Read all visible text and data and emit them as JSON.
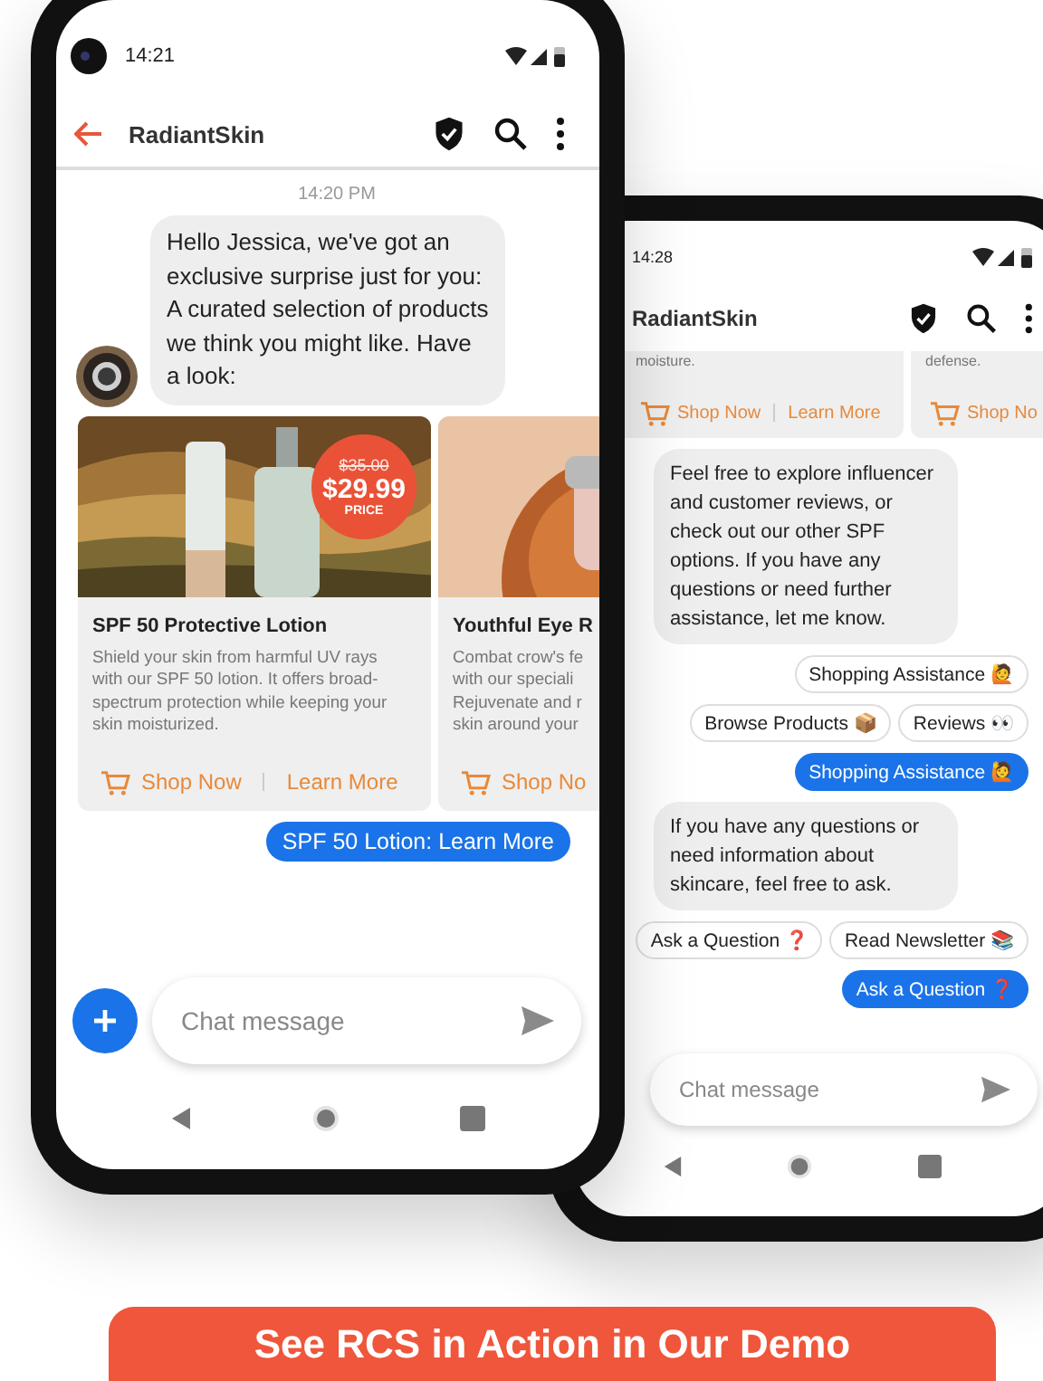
{
  "front_phone": {
    "status_time": "14:21",
    "title": "RadiantSkin",
    "timestamp": "14:20 PM",
    "messages": [
      {
        "kind": "bubble",
        "text": "Hello Jessica, we've got an exclusive surprise just for you: A curated selection of products we think you might like. Have a look:"
      },
      {
        "kind": "carousel",
        "cards": [
          {
            "price_old": "$35.00",
            "price_new": "$29.99",
            "price_label": "PRICE",
            "title": "SPF 50 Protective Lotion",
            "description_lines": [
              "Shield your skin from harmful UV rays",
              "with our SPF 50 lotion. It offers broad-",
              "spectrum protection while keeping your",
              "skin moisturized."
            ],
            "shop": "Shop Now",
            "learn": "Learn More"
          },
          {
            "title": "Youthful Eye R",
            "description_lines": [
              "Combat crow's fe",
              "with our speciali",
              "Rejuvenate and r",
              "skin around your"
            ],
            "shop": "Shop No"
          }
        ]
      },
      {
        "kind": "reply",
        "text": "SPF 50 Lotion: Learn More"
      }
    ],
    "input_placeholder": "Chat message"
  },
  "back_phone": {
    "status_time": "14:28",
    "title": "RadiantSkin",
    "messages": [
      {
        "kind": "carousel",
        "cards": [
          {
            "description_lines": [
              "moisture."
            ],
            "shop": "Shop Now",
            "learn": "Learn More"
          },
          {
            "description_lines": [
              "defense."
            ],
            "shop": "Shop No"
          }
        ]
      },
      {
        "kind": "bubble",
        "text": "Feel free to explore influencer and customer reviews, or check out our other SPF options. If you have any questions or need further assistance, let me know."
      },
      {
        "kind": "suggestions",
        "rows": [
          [
            "Shopping Assistance 🙋"
          ],
          [
            "Browse Products 📦",
            "Reviews 👀"
          ]
        ]
      },
      {
        "kind": "reply",
        "text": "Shopping Assistance 🙋"
      },
      {
        "kind": "bubble",
        "text": "If you have any questions or need information about skincare, feel free to ask."
      },
      {
        "kind": "suggestions",
        "rows": [
          [
            "Ask a Question ❓",
            "Read Newsletter 📚"
          ]
        ]
      },
      {
        "kind": "reply",
        "text": "Ask a Question ❓"
      }
    ],
    "input_placeholder": "Chat message"
  },
  "cta": "See RCS in Action in Our Demo"
}
